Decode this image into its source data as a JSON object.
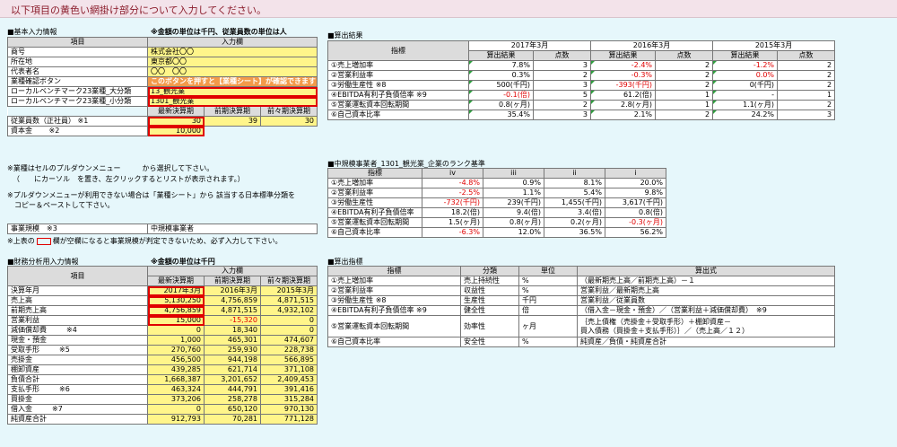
{
  "banner": "以下項目の黄色い網掛け部分について入力してください。",
  "basic": {
    "section": "■基本入力情報",
    "unit_note": "※金額の単位は千円、従業員数の単位は人",
    "col_item": "項目",
    "col_input": "入力欄",
    "rows": [
      {
        "label": "商号",
        "value": "株式会社〇〇"
      },
      {
        "label": "所在地",
        "value": "東京都〇〇"
      },
      {
        "label": "代表者名",
        "value": "〇〇　〇〇"
      }
    ],
    "confirm_label": "業種確認ボタン",
    "confirm_button": "このボタンを押すと【業種シート】が確認できます",
    "bench_major_label": "ローカルベンチマーク23業種_大分類",
    "bench_major_value": "13_観光業",
    "bench_minor_label": "ローカルベンチマーク23業種_小分類",
    "bench_minor_value": "1301_観光業",
    "period_headers": [
      "最新決算期",
      "前期決算期",
      "前々期決算期"
    ],
    "employees_label": "従業員数（正社員）",
    "employees_note": "※1",
    "employees_values": [
      "30",
      "39",
      "30"
    ],
    "capital_label": "資本金",
    "capital_note": "※2",
    "capital_value": "10,000",
    "notes": [
      "※業種はセルのプルダウンメニュー　　　から選択して下さい。",
      "（　　にカーソル　を置き、左クリックするとリストが表示されます。）",
      "※プルダウンメニューが利用できない場合は「業種シート」から 該当する日本標準分類を",
      "　コピー＆ペーストして下さい。"
    ],
    "scale_label": "事業規模",
    "scale_note": "※3",
    "scale_value": "中規模事業者",
    "scale_hint_a": "※上表の",
    "scale_hint_b": "欄が空欄になると事業規模が判定できないため、必ず入力して下さい。"
  },
  "results": {
    "section": "■算出結果",
    "years": [
      "2017年3月",
      "2016年3月",
      "2015年3月"
    ],
    "col_indicator": "指標",
    "col_value": "算出結果",
    "col_points": "点数",
    "rows": [
      {
        "name": "①売上増加率",
        "v": [
          {
            "t": "7.8%",
            "red": false
          },
          {
            "t": "-2.4%",
            "red": true
          },
          {
            "t": "-1.2%",
            "red": true
          }
        ],
        "p": [
          "3",
          "2",
          "2"
        ]
      },
      {
        "name": "②営業利益率",
        "v": [
          {
            "t": "0.3%",
            "red": false
          },
          {
            "t": "-0.3%",
            "red": true
          },
          {
            "t": "0.0%",
            "red": true
          }
        ],
        "p": [
          "2",
          "2",
          "2"
        ]
      },
      {
        "name": "③労働生産性 ※8",
        "v": [
          {
            "t": "500(千円)",
            "red": false
          },
          {
            "t": "-393(千円)",
            "red": true
          },
          {
            "t": "0(千円)",
            "red": false
          }
        ],
        "p": [
          "3",
          "2",
          "2"
        ]
      },
      {
        "name": "④EBITDA有利子負債倍率 ※9",
        "v": [
          {
            "t": "-0.1(倍)",
            "red": true
          },
          {
            "t": "61.2(倍)",
            "red": false
          },
          {
            "t": "-",
            "red": false
          }
        ],
        "p": [
          "5",
          "1",
          "1"
        ]
      },
      {
        "name": "⑤営業運転資本回転期間",
        "v": [
          {
            "t": "0.8(ヶ月)",
            "red": false
          },
          {
            "t": "2.8(ヶ月)",
            "red": false
          },
          {
            "t": "1.1(ヶ月)",
            "red": false
          }
        ],
        "p": [
          "2",
          "1",
          "2"
        ]
      },
      {
        "name": "⑥自己資本比率",
        "v": [
          {
            "t": "35.4%",
            "red": false
          },
          {
            "t": "2.1%",
            "red": false
          },
          {
            "t": "24.2%",
            "red": false
          }
        ],
        "p": [
          "3",
          "2",
          "3"
        ]
      }
    ]
  },
  "rank": {
    "section": "■中規模事業者_1301_観光業_企業のランク基準",
    "col_indicator": "指標",
    "cols": [
      "iv",
      "iii",
      "ii",
      "i"
    ],
    "rows": [
      {
        "name": "①売上増加率",
        "v": [
          {
            "t": "-4.8%",
            "red": true
          },
          {
            "t": "0.9%",
            "red": false
          },
          {
            "t": "8.1%",
            "red": false
          },
          {
            "t": "20.0%",
            "red": false
          }
        ]
      },
      {
        "name": "②営業利益率",
        "v": [
          {
            "t": "-2.5%",
            "red": true
          },
          {
            "t": "1.1%",
            "red": false
          },
          {
            "t": "5.4%",
            "red": false
          },
          {
            "t": "9.8%",
            "red": false
          }
        ]
      },
      {
        "name": "③労働生産性",
        "v": [
          {
            "t": "-732(千円)",
            "red": true
          },
          {
            "t": "239(千円)",
            "red": false
          },
          {
            "t": "1,455(千円)",
            "red": false
          },
          {
            "t": "3,617(千円)",
            "red": false
          }
        ]
      },
      {
        "name": "④EBITDA有利子負債倍率",
        "v": [
          {
            "t": "18.2(倍)",
            "red": false
          },
          {
            "t": "9.4(倍)",
            "red": false
          },
          {
            "t": "3.4(倍)",
            "red": false
          },
          {
            "t": "0.8(倍)",
            "red": false
          }
        ]
      },
      {
        "name": "⑤営業運転資本回転期間",
        "v": [
          {
            "t": "1.5(ヶ月)",
            "red": false
          },
          {
            "t": "0.8(ヶ月)",
            "red": false
          },
          {
            "t": "0.2(ヶ月)",
            "red": false
          },
          {
            "t": "-0.3(ヶ月)",
            "red": true
          }
        ]
      },
      {
        "name": "⑥自己資本比率",
        "v": [
          {
            "t": "-6.3%",
            "red": true
          },
          {
            "t": "12.0%",
            "red": false
          },
          {
            "t": "36.5%",
            "red": false
          },
          {
            "t": "56.2%",
            "red": false
          }
        ]
      }
    ]
  },
  "finance": {
    "section": "■財務分析用入力情報",
    "unit_note": "※金額の単位は千円",
    "col_item": "項目",
    "col_input": "入力欄",
    "periods": [
      "最新決算期",
      "前期決算期",
      "前々期決算期"
    ],
    "rows": [
      {
        "label": "決算年月",
        "note": "",
        "v": [
          "2017年3月",
          "2016年3月",
          "2015年3月"
        ]
      },
      {
        "label": "売上高",
        "note": "",
        "v": [
          "5,130,250",
          "4,756,859",
          "4,871,515"
        ]
      },
      {
        "label": "前期売上高",
        "note": "",
        "v": [
          "4,756,859",
          "4,871,515",
          "4,932,102"
        ]
      },
      {
        "label": "営業利益",
        "note": "",
        "v": [
          "15,000",
          "-15,320",
          "0"
        ]
      },
      {
        "label": "減価償却費",
        "note": "※4",
        "v": [
          "0",
          "18,340",
          "0"
        ]
      },
      {
        "label": "現金・預金",
        "note": "",
        "v": [
          "1,000",
          "465,301",
          "474,607"
        ]
      },
      {
        "label": "受取手形",
        "note": "※5",
        "v": [
          "270,760",
          "259,930",
          "228,738"
        ]
      },
      {
        "label": "売掛金",
        "note": "",
        "v": [
          "456,500",
          "944,198",
          "566,895"
        ]
      },
      {
        "label": "棚卸資産",
        "note": "",
        "v": [
          "439,285",
          "621,714",
          "371,108"
        ]
      },
      {
        "label": "負債合計",
        "note": "",
        "v": [
          "1,668,387",
          "3,201,652",
          "2,409,453"
        ]
      },
      {
        "label": "支払手形",
        "note": "※6",
        "v": [
          "463,324",
          "444,791",
          "391,416"
        ]
      },
      {
        "label": "買掛金",
        "note": "",
        "v": [
          "373,206",
          "258,278",
          "315,284"
        ]
      },
      {
        "label": "借入金",
        "note": "※7",
        "v": [
          "0",
          "650,120",
          "970,130"
        ]
      },
      {
        "label": "純資産合計",
        "note": "",
        "v": [
          "912,793",
          "70,281",
          "771,128"
        ]
      }
    ]
  },
  "indicators": {
    "section": "■算出指標",
    "cols": [
      "指標",
      "分類",
      "単位",
      "算出式"
    ],
    "rows": [
      {
        "name": "①売上増加率",
        "cat": "売上持続性",
        "unit": "%",
        "formula": [
          "（最新期売上高／前期売上高）－１"
        ]
      },
      {
        "name": "②営業利益率",
        "cat": "収益性",
        "unit": "%",
        "formula": [
          "営業利益／最新期売上高"
        ]
      },
      {
        "name": "③労働生産性 ※8",
        "cat": "生産性",
        "unit": "千円",
        "formula": [
          "営業利益／従業員数"
        ]
      },
      {
        "name": "④EBITDA有利子負債倍率 ※9",
        "cat": "健全性",
        "unit": "倍",
        "formula": [
          "（借入金－現金・預金）／（営業利益＋減価償却費）　※9"
        ]
      },
      {
        "name": "⑤営業運転資本回転期間",
        "cat": "効率性",
        "unit": "ヶ月",
        "formula": [
          "｛売上債権（売掛金＋受取手形）＋棚卸資産－",
          "買入債務（買掛金＋支払手形）｝／（売上高／１２）"
        ]
      },
      {
        "name": "⑥自己資本比率",
        "cat": "安全性",
        "unit": "%",
        "formula": [
          "純資産／負債・純資産合計"
        ]
      }
    ]
  }
}
